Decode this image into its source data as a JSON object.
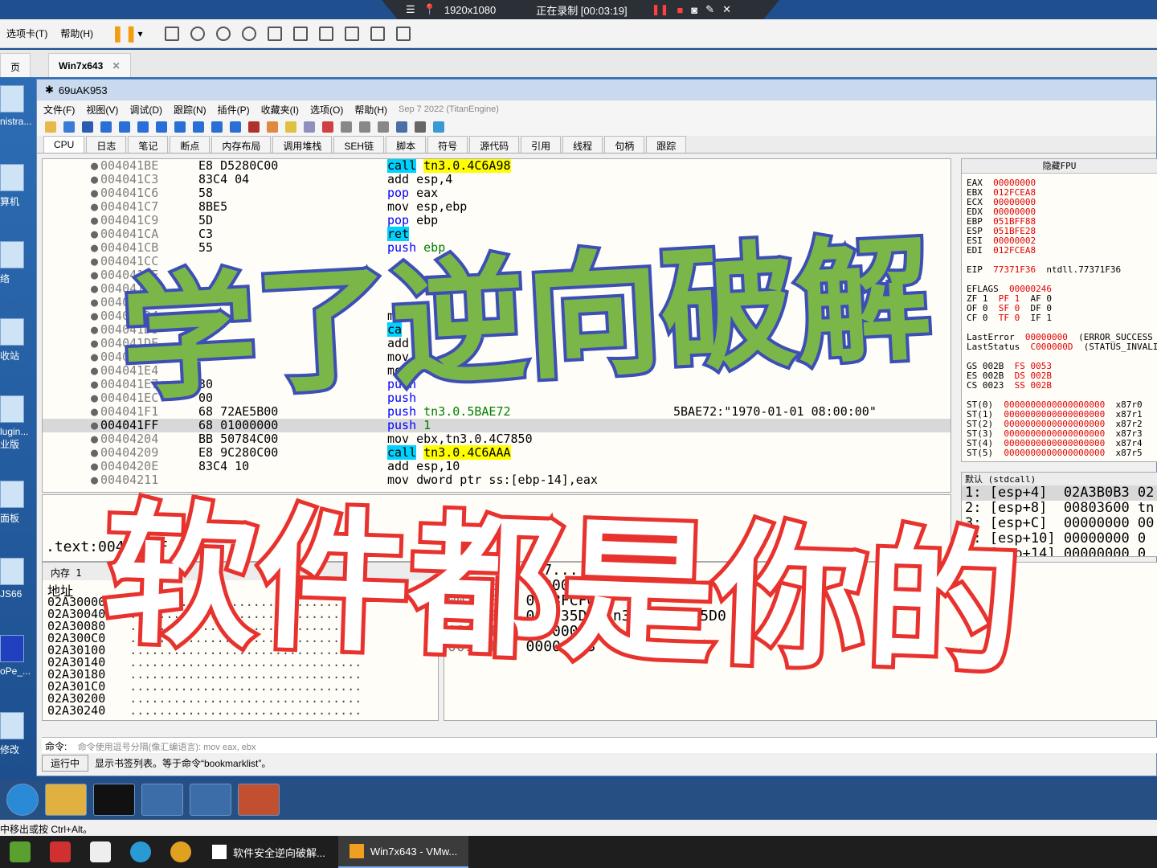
{
  "recorder": {
    "resolution": "1920x1080",
    "status": "正在录制 [00:03:19]"
  },
  "vm": {
    "menu": [
      "选项卡(T)",
      "帮助(H)"
    ],
    "tabs": [
      "页",
      "Win7x643"
    ]
  },
  "desktop": {
    "icons": [
      "nistra...",
      "算机",
      "络",
      "收站",
      "lugin... 业版",
      "面板",
      "JS66",
      "oPe_...",
      "修改"
    ]
  },
  "dbg": {
    "title": "69uAK953",
    "menu": [
      "文件(F)",
      "视图(V)",
      "调试(D)",
      "跟踪(N)",
      "插件(P)",
      "收藏夹(I)",
      "选项(O)",
      "帮助(H)"
    ],
    "build_date": "Sep 7 2022 (TitanEngine)",
    "tabs": [
      "CPU",
      "日志",
      "笔记",
      "断点",
      "内存布局",
      "调用堆栈",
      "SEH链",
      "脚本",
      "符号",
      "源代码",
      "引用",
      "线程",
      "句柄",
      "跟踪"
    ],
    "disasm": [
      {
        "addr": "004041BE",
        "bytes": "E8 D5280C00",
        "op": "call",
        "arg": "tn3.0.4C6A98",
        "kind": "call",
        "cmt": ""
      },
      {
        "addr": "004041C3",
        "bytes": "83C4 04",
        "op": "add",
        "arg": "esp,4",
        "kind": "plain",
        "cmt": ""
      },
      {
        "addr": "004041C6",
        "bytes": "58",
        "op": "pop",
        "arg": "eax",
        "kind": "pop",
        "cmt": ""
      },
      {
        "addr": "004041C7",
        "bytes": "8BE5",
        "op": "mov",
        "arg": "esp,ebp",
        "kind": "plain",
        "cmt": ""
      },
      {
        "addr": "004041C9",
        "bytes": "5D",
        "op": "pop",
        "arg": "ebp",
        "kind": "pop",
        "cmt": ""
      },
      {
        "addr": "004041CA",
        "bytes": "C3",
        "op": "ret",
        "arg": "",
        "kind": "ret",
        "cmt": ""
      },
      {
        "addr": "004041CB",
        "bytes": "55",
        "op": "push",
        "arg": "ebp",
        "kind": "push",
        "cmt": ""
      },
      {
        "addr": "004041CC",
        "bytes": "",
        "op": "",
        "arg": "",
        "kind": "plain",
        "cmt": ""
      },
      {
        "addr": "004041CE",
        "bytes": "",
        "op": "",
        "arg": "",
        "kind": "plain",
        "cmt": ""
      },
      {
        "addr": "004041D0",
        "bytes": "",
        "op": "",
        "arg": "",
        "kind": "plain",
        "cmt": ""
      },
      {
        "addr": "004041D2",
        "bytes": "",
        "op": "",
        "arg": "",
        "kind": "plain",
        "cmt": ""
      },
      {
        "addr": "004041D4",
        "bytes": "00",
        "op": "mo",
        "arg": "",
        "kind": "plain",
        "cmt": ""
      },
      {
        "addr": "004041D9",
        "bytes": "00",
        "op": "ca",
        "arg": "",
        "kind": "call",
        "cmt": ""
      },
      {
        "addr": "004041DE",
        "bytes": "",
        "op": "add",
        "arg": "",
        "kind": "plain",
        "cmt": ""
      },
      {
        "addr": "004041E1",
        "bytes": "",
        "op": "mov",
        "arg": "",
        "kind": "plain",
        "cmt": ""
      },
      {
        "addr": "004041E4",
        "bytes": "",
        "op": "mo",
        "arg": "x",
        "kind": "plain",
        "cmt": ""
      },
      {
        "addr": "004041E7",
        "bytes": "30",
        "op": "push",
        "arg": "",
        "kind": "push",
        "cmt": ""
      },
      {
        "addr": "004041EC",
        "bytes": "00",
        "op": "push",
        "arg": "",
        "kind": "push",
        "cmt": ""
      },
      {
        "addr": "004041F1",
        "bytes": "68 72AE5B00",
        "op": "push",
        "arg": "tn3.0.5BAE72",
        "kind": "push",
        "cmt": "5BAE72:\"1970-01-01 08:00:00\""
      },
      {
        "addr": "004041FF",
        "bytes": "68 01000000",
        "op": "push",
        "arg": "1",
        "kind": "push",
        "cmt": "",
        "sel": true
      },
      {
        "addr": "00404204",
        "bytes": "BB 50784C00",
        "op": "mov",
        "arg": "ebx,tn3.0.4C7850",
        "kind": "plain",
        "cmt": ""
      },
      {
        "addr": "00404209",
        "bytes": "E8 9C280C00",
        "op": "call",
        "arg": "tn3.0.4C6AAA",
        "kind": "call",
        "cmt": ""
      },
      {
        "addr": "0040420E",
        "bytes": "83C4 10",
        "op": "add",
        "arg": "esp,10",
        "kind": "plain",
        "cmt": ""
      },
      {
        "addr": "00404211",
        "bytes": "",
        "op": "mov",
        "arg": "dword ptr ss:[ebp-14],eax",
        "kind": "plain",
        "cmt": ""
      }
    ],
    "regs_header": "隐藏FPU",
    "regs": [
      [
        "EAX",
        "00000000",
        ""
      ],
      [
        "EBX",
        "012FCEA8",
        ""
      ],
      [
        "ECX",
        "00000000",
        ""
      ],
      [
        "EDX",
        "00000000",
        ""
      ],
      [
        "EBP",
        "051BFF88",
        ""
      ],
      [
        "ESP",
        "051BFE28",
        ""
      ],
      [
        "ESI",
        "00000002",
        ""
      ],
      [
        "EDI",
        "012FCEA8",
        ""
      ],
      [
        "",
        "",
        ""
      ],
      [
        "EIP",
        "77371F36",
        "ntdll.77371F36"
      ],
      [
        "",
        "",
        ""
      ],
      [
        "EFLAGS",
        "00000246",
        ""
      ],
      [
        "ZF 1",
        "PF 1",
        "AF 0"
      ],
      [
        "OF 0",
        "SF 0",
        "DF 0"
      ],
      [
        "CF 0",
        "TF 0",
        "IF 1"
      ],
      [
        "",
        "",
        ""
      ],
      [
        "LastError",
        "00000000",
        "(ERROR_SUCCESS"
      ],
      [
        "LastStatus",
        "C000000D",
        "(STATUS_INVALI"
      ],
      [
        "",
        "",
        ""
      ],
      [
        "GS 002B",
        "FS 0053",
        ""
      ],
      [
        "ES 002B",
        "DS 002B",
        ""
      ],
      [
        "CS 0023",
        "SS 002B",
        ""
      ],
      [
        "",
        "",
        ""
      ],
      [
        "ST(0)",
        "0000000000000000000",
        "x87r0"
      ],
      [
        "ST(1)",
        "0000000000000000000",
        "x87r1"
      ],
      [
        "ST(2)",
        "0000000000000000000",
        "x87r2"
      ],
      [
        "ST(3)",
        "0000000000000000000",
        "x87r3"
      ],
      [
        "ST(4)",
        "0000000000000000000",
        "x87r4"
      ],
      [
        "ST(5)",
        "0000000000000000000",
        "x87r5"
      ]
    ],
    "args_header": "默认 (stdcall)",
    "args": [
      "1: [esp+4]  02A3B0B3 02",
      "2: [esp+8]  00803600 tn",
      "3: [esp+C]  00000000 00",
      "4: [esp+10] 00000000 0",
      "5: [esp+14] 00000000 0"
    ],
    "info": ".text:004041FF",
    "dump_tab": "内存 1",
    "dump_col": "地址",
    "dump_rows": [
      "02A30000",
      "02A30040",
      "02A30080",
      "02A300C0",
      "02A30100",
      "02A30140",
      "02A30180",
      "02A301C0",
      "02A30200",
      "02A30240"
    ],
    "stack": [
      [
        "0018FBE8",
        "047......",
        ""
      ],
      [
        "0018FBEC",
        "00000000",
        ""
      ],
      [
        "0018FBF0",
        "0018FCF0",
        ""
      ],
      [
        "0018FBF4",
        "008035D0",
        "tn3.0.008035D0"
      ],
      [
        "0018FBF8",
        "00000000",
        ""
      ],
      [
        "0018FBFC",
        "00000003",
        ""
      ]
    ],
    "cmd_label": "命令:",
    "cmd_placeholder": "命令使用逗号分隔(像汇编语言): mov eax, ebx",
    "status_state": "运行中",
    "status_msg": "显示书签列表。等于命令“bookmarklist”。"
  },
  "overlay": {
    "line1": "学了逆向破解",
    "line2": "软件都是你的"
  },
  "vm_hint": "中移出或按 Ctrl+Alt。",
  "taskbar": {
    "apps": [
      "软件安全逆向破解...",
      "Win7x643 - VMw..."
    ]
  },
  "colors": {
    "overlay1": "#7bb648",
    "overlay1_stroke": "#3d4fb5",
    "overlay2_stroke": "#e8322e",
    "call_bg": "#00d2ff",
    "target_bg": "#ffff00"
  }
}
